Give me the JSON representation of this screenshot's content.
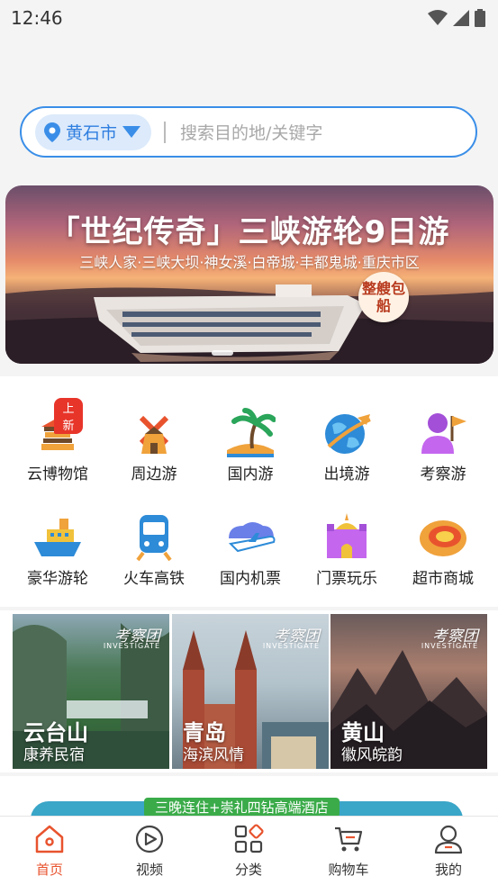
{
  "status_bar": {
    "time": "12:46"
  },
  "search": {
    "city": "黄石市",
    "placeholder": "搜索目的地/关键字"
  },
  "banner": {
    "title": "「世纪传奇」三峡游轮9日游",
    "subtitle": "三峡人家·三峡大坝·神女溪·白帝城·丰都鬼城·重庆市区",
    "badge": "整艘包船"
  },
  "categories": [
    {
      "label": "云博物馆",
      "icon": "museum-icon",
      "tag": "上新"
    },
    {
      "label": "周边游",
      "icon": "windmill-icon"
    },
    {
      "label": "国内游",
      "icon": "palm-island-icon"
    },
    {
      "label": "出境游",
      "icon": "globe-plane-icon"
    },
    {
      "label": "考察游",
      "icon": "person-flag-icon"
    },
    {
      "label": "豪华游轮",
      "icon": "cruise-ship-icon"
    },
    {
      "label": "火车高铁",
      "icon": "train-icon"
    },
    {
      "label": "国内机票",
      "icon": "airplane-icon"
    },
    {
      "label": "门票玩乐",
      "icon": "castle-ticket-icon"
    },
    {
      "label": "超市商城",
      "icon": "fruit-icon"
    }
  ],
  "promos": [
    {
      "title": "云台山",
      "subtitle": "康养民宿",
      "brand": "考察团",
      "brand_en": "INVESTIGATE"
    },
    {
      "title": "青岛",
      "subtitle": "海滨风情",
      "brand": "考察团",
      "brand_en": "INVESTIGATE"
    },
    {
      "title": "黄山",
      "subtitle": "徽风皖韵",
      "brand": "考察团",
      "brand_en": "INVESTIGATE"
    }
  ],
  "strip": {
    "tag": "三晚连住+崇礼四钻高端酒店"
  },
  "tabs": [
    {
      "label": "首页",
      "icon": "home-icon",
      "active": true
    },
    {
      "label": "视频",
      "icon": "play-icon"
    },
    {
      "label": "分类",
      "icon": "category-icon"
    },
    {
      "label": "购物车",
      "icon": "cart-icon"
    },
    {
      "label": "我的",
      "icon": "user-icon"
    }
  ],
  "colors": {
    "accent": "#3a8ee8",
    "active_tab": "#e8532e",
    "new_tag": "#e8352a"
  }
}
